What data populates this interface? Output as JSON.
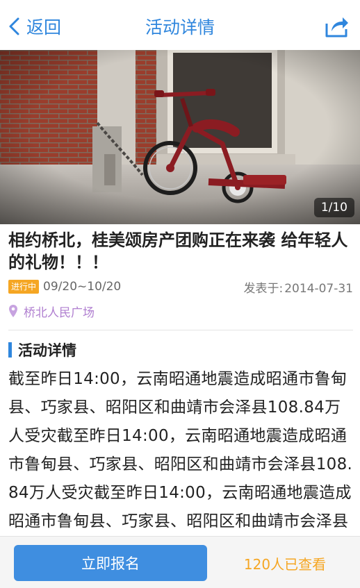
{
  "navbar": {
    "back_label": "返回",
    "title": "活动详情",
    "accent_color": "#2f86dd"
  },
  "hero": {
    "counter": "1/10"
  },
  "event": {
    "title": "相约桥北，桂美颂房产团购正在来袭  给年轻人的礼物！！！",
    "status": "进行中",
    "date_range": "09/20~10/20",
    "posted_label": "发表于:",
    "posted_date": "2014-07-31",
    "location": "桥北人民广场"
  },
  "details": {
    "heading": "活动详情",
    "body": "截至昨日14:00，云南昭通地震造成昭通市鲁甸县、巧家县、昭阳区和曲靖市会泽县108.84万人受灾截至昨日14:00，云南昭通地震造成昭通市鲁甸县、巧家县、昭阳区和曲靖市会泽县108.84万人受灾截至昨日14:00，云南昭通地震造成昭通市鲁甸县、巧家县、昭阳区和曲靖市会泽县截至昨日"
  },
  "bottom": {
    "signup_label": "立即报名",
    "view_count": "120人已查看"
  },
  "icons": {
    "back": "chevron-left-icon",
    "share": "share-icon",
    "location": "location-pin-icon"
  }
}
